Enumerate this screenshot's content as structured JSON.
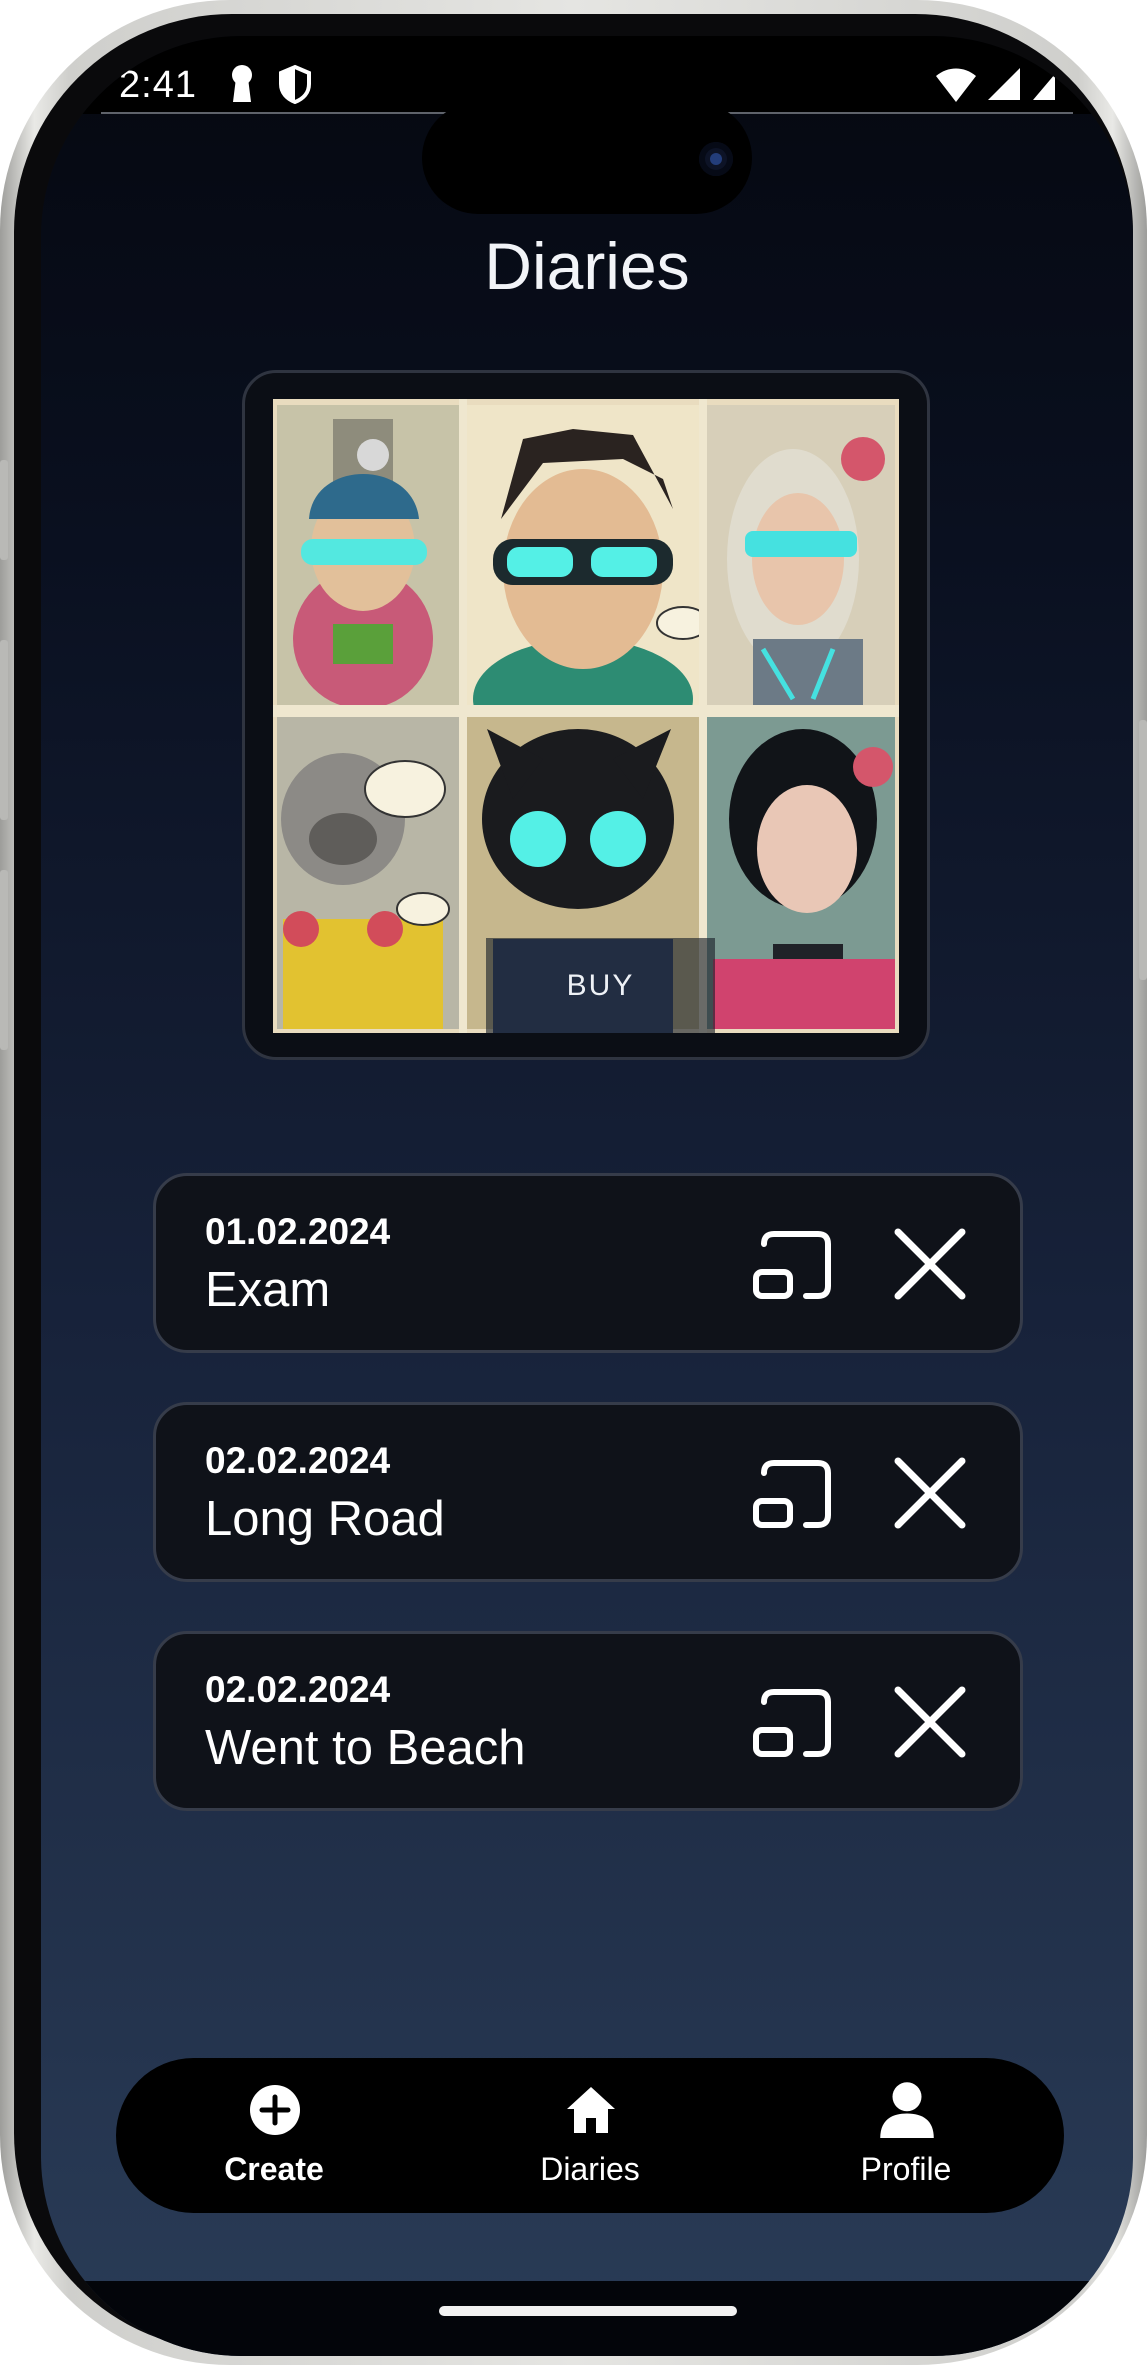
{
  "status_bar": {
    "time": "2:41",
    "icons": [
      "keyhole-icon",
      "shield-icon",
      "wifi-icon",
      "cellular-signal-icon",
      "battery-icon"
    ]
  },
  "header": {
    "title": "Diaries"
  },
  "product": {
    "image_description_icon": "comic-art-image",
    "buy_label": "BUY"
  },
  "entries": [
    {
      "date": "01.02.2024",
      "title": "Exam"
    },
    {
      "date": "02.02.2024",
      "title": "Long Road"
    },
    {
      "date": "02.02.2024",
      "title": "Went to Beach"
    }
  ],
  "entry_actions": {
    "open_icon": "cast-open-icon",
    "delete_icon": "close-icon"
  },
  "nav": {
    "items": [
      {
        "label": "Create",
        "icon": "plus-circle-icon",
        "active": true
      },
      {
        "label": "Diaries",
        "icon": "home-icon",
        "active": false
      },
      {
        "label": "Profile",
        "icon": "person-icon",
        "active": false
      }
    ]
  },
  "colors": {
    "background_top": "#050810",
    "background_bottom": "#2a3c57",
    "card_background": "#0f1219",
    "card_border": "#363c4a",
    "text": "#ffffff",
    "nav_background": "#000000"
  }
}
